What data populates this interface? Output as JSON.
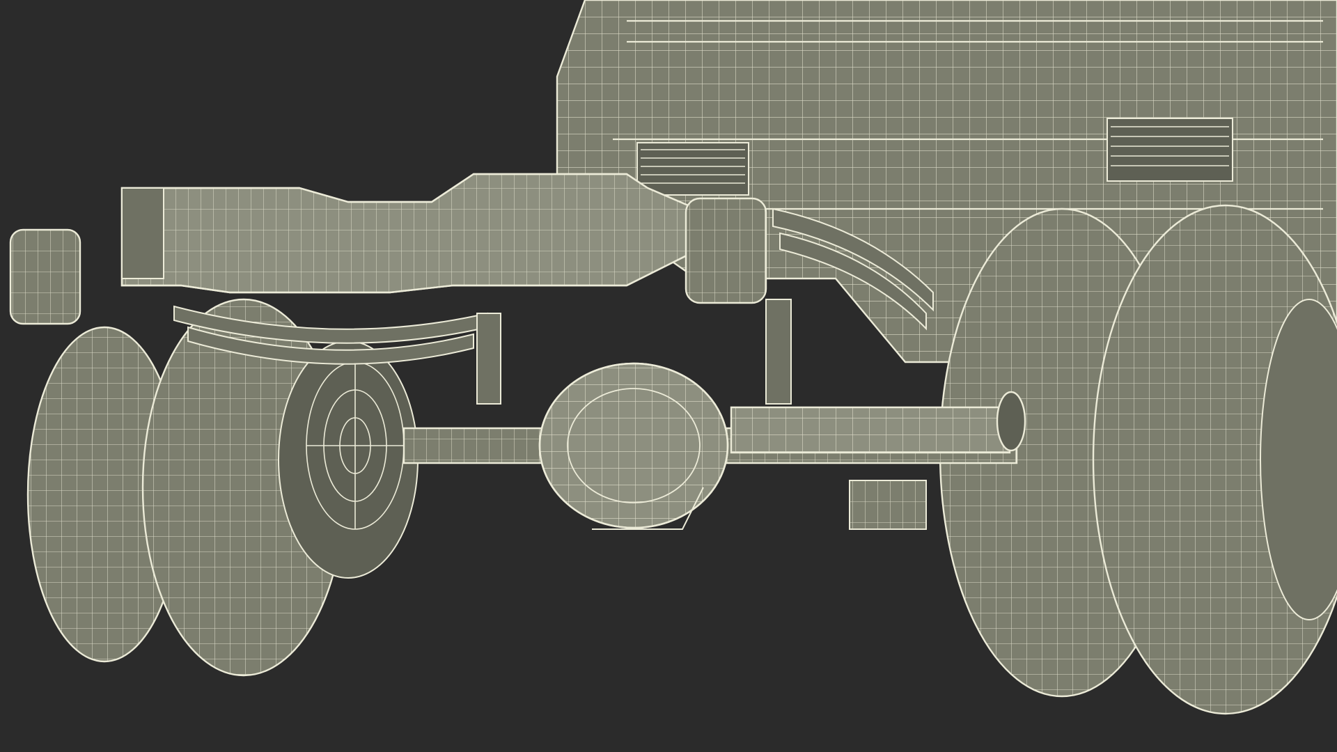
{
  "scene": {
    "background_color": "#2b2b2b",
    "surface_color": "#7c7e6e",
    "surface_shadow_color": "#5e6054",
    "surface_light_color": "#8d8f7f",
    "wire_color": "#ecebd8"
  }
}
